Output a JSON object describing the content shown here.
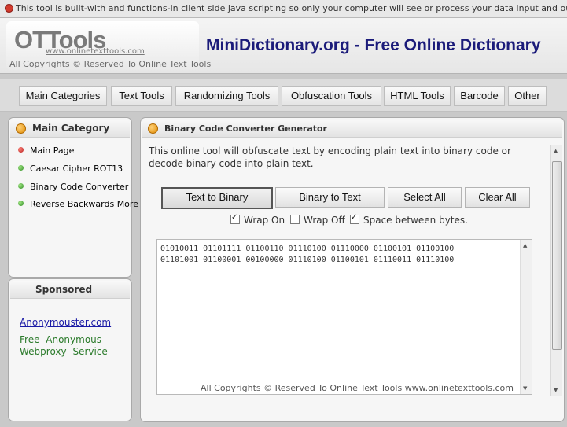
{
  "notice": {
    "text": "This tool is built-with and functions-in client side java scripting so only your computer will see or process your data input and output."
  },
  "header": {
    "logo": "OTTools",
    "url": "www.onlinetexttools.com",
    "copyright": "All Copyrights © Reserved To Online Text Tools",
    "site_title": "MiniDictionary.org - Free Online Dictionary"
  },
  "menu": [
    {
      "label": "Main Categories"
    },
    {
      "label": "Text Tools"
    },
    {
      "label": "Randomizing Tools"
    },
    {
      "label": "Obfuscation Tools"
    },
    {
      "label": "HTML Tools"
    },
    {
      "label": "Barcode"
    },
    {
      "label": "Other"
    }
  ],
  "sidebar": {
    "title": "Main Category",
    "items": [
      {
        "label": "Main Page"
      },
      {
        "label": "Caesar Cipher ROT13"
      },
      {
        "label": "Binary Code Converter"
      },
      {
        "label": "Reverse Backwards More"
      }
    ]
  },
  "sponsored": {
    "title": "Sponsored",
    "link": "Anonymouster.com",
    "text": "Free Anonymous Webproxy Service"
  },
  "main": {
    "title": "Binary Code Converter Generator",
    "description": "This online tool will obfuscate text by encoding plain text into binary code or decode binary code into plain text.",
    "buttons": {
      "text_to_binary": "Text to Binary",
      "binary_to_text": "Binary to Text",
      "select_all": "Select All",
      "clear_all": "Clear All"
    },
    "options": {
      "wrap_on": {
        "label": "Wrap On",
        "checked": true
      },
      "wrap_off": {
        "label": "Wrap Off",
        "checked": false
      },
      "space_between": {
        "label": "Space between bytes.",
        "checked": true
      }
    },
    "output": "01010011 01101111 01100110 01110100 01110000 01100101 01100100 01101001 01100001 00100000 01110100 01100101 01110011 01110100",
    "footer": "All Copyrights © Reserved To Online Text Tools  www.onlinetexttools.com"
  },
  "colors": {
    "title_blue": "#1b1b7a",
    "link_blue": "#1a1aa6",
    "sponsor_green": "#2a7a2a"
  }
}
